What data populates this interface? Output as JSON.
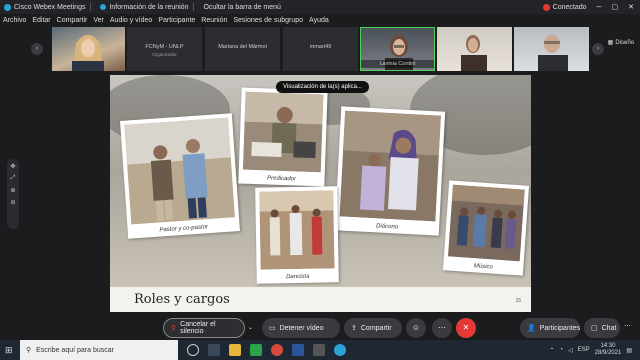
{
  "titlebar": {
    "app": "Cisco Webex Meetings",
    "info": "Información de la reunión",
    "hide_menu": "Ocultar la barra de menú",
    "status": "Conectado"
  },
  "menu": [
    "Archivo",
    "Editar",
    "Compartir",
    "Ver",
    "Audio y vídeo",
    "Participante",
    "Reunión",
    "Sesiones de subgrupo",
    "Ayuda"
  ],
  "participants": {
    "tiles": [
      {
        "name": "FCNyM - UNLP",
        "subtitle": "Organizador"
      },
      {
        "name": "Mariana del Mármol"
      },
      {
        "name": "mmart49"
      },
      {
        "name": "Lavinia Contini"
      }
    ],
    "layout_label": "Diseño"
  },
  "slide": {
    "title": "Roles y cargos",
    "number": "15",
    "tooltip": "Visualización de la(s) aplica...",
    "captions": {
      "pastor": "Pastor y co-pastor",
      "predicador": "Predicador",
      "diacono": "Diácono",
      "dancista": "Dancista",
      "musico": "Músico"
    }
  },
  "controls": {
    "mute": "Cancelar el silencio",
    "stop_video": "Detener vídeo",
    "share": "Compartir",
    "participants": "Participantes",
    "chat": "Chat"
  },
  "taskbar": {
    "search_placeholder": "Escribe aquí para buscar",
    "lang": "ESP",
    "time": "14:30",
    "date": "28/9/2021"
  },
  "colors": {
    "end_call": "#e53935",
    "connected": "#e53935",
    "bg": "#1b1c1e"
  }
}
